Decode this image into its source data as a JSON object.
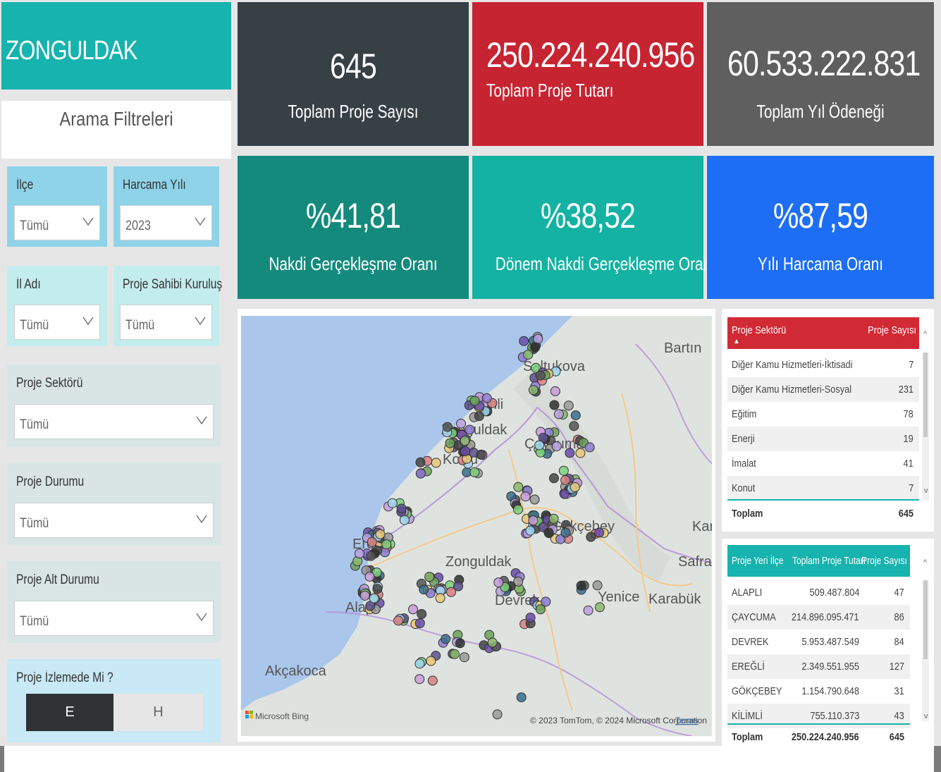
{
  "title": "ZONGULDAK",
  "filters": {
    "header": "Arama Filtreleri",
    "ilce": {
      "label": "İlçe",
      "value": "Tümü"
    },
    "harcama_yili": {
      "label": "Harcama Yılı",
      "value": "2023"
    },
    "il_adi": {
      "label": "İl Adı",
      "value": "Tümü"
    },
    "proje_sahibi": {
      "label": "Proje Sahibi Kuruluş",
      "value": "Tümü"
    },
    "proje_sektoru": {
      "label": "Proje Sektörü",
      "value": "Tümü"
    },
    "proje_durumu": {
      "label": "Proje Durumu",
      "value": "Tümü"
    },
    "proje_alt_durumu": {
      "label": "Proje Alt Durumu",
      "value": "Tümü"
    },
    "proje_izlemede": {
      "label": "Proje İzlemede Mi ?",
      "option_e": "E",
      "option_h": "H",
      "selected": "E"
    }
  },
  "kpis": {
    "proje_sayisi": {
      "value": "645",
      "label": "Toplam Proje Sayısı",
      "color": "#374045"
    },
    "proje_tutari": {
      "value": "250.224.240.956",
      "label": "Toplam Proje Tutarı",
      "color": "#c72432"
    },
    "yil_odenegi": {
      "value": "60.533.222.831",
      "label": "Toplam Yıl Ödeneği",
      "color": "#5f5f5f"
    },
    "nakdi": {
      "value": "%41,81",
      "label": "Nakdi Gerçekleşme Oranı",
      "color": "#138a7c"
    },
    "donem_nakdi": {
      "value": "%38,52",
      "label": "Dönem Nakdi Gerçekleşme Oranı",
      "color": "#13b2a2"
    },
    "harcama": {
      "value": "%87,59",
      "label": "Yılı Harcama Oranı",
      "color": "#1d6ef5"
    }
  },
  "map": {
    "labels": {
      "bartin": "Bartın",
      "kilimli": "Kilimli",
      "zonguldak_top": "Zonguldak",
      "kozlu": "Kozlu",
      "caycuma": "Çaycuma",
      "kara": "Kara",
      "safran": "Safran",
      "eregli": "Ereğli",
      "zonguldak": "Zonguldak",
      "alapli": "Alaplı",
      "devrek": "Devrek",
      "yenice": "Yenice",
      "karabuk": "Karabük",
      "akcakoca": "Akçakoca",
      "gokcebey": "Gökçebey",
      "saltukova": "Saltukova"
    },
    "attribution": "© 2023 TomTom, © 2024 Microsoft Corporation",
    "terms": "Terms",
    "bing": "Microsoft Bing"
  },
  "sector_table": {
    "headers": [
      "Proje Sektörü",
      "Proje Sayısı"
    ],
    "rows": [
      {
        "name": "Diğer Kamu Hizmetleri-İktisadi",
        "count": "7"
      },
      {
        "name": "Diğer Kamu Hizmetleri-Sosyal",
        "count": "231"
      },
      {
        "name": "Eğitim",
        "count": "78"
      },
      {
        "name": "Enerji",
        "count": "19"
      },
      {
        "name": "İmalat",
        "count": "41"
      },
      {
        "name": "Konut",
        "count": "7"
      }
    ],
    "total_label": "Toplam",
    "total": "645"
  },
  "district_table": {
    "headers": [
      "Proje Yeri İlçe",
      "Toplam Proje Tutarı",
      "Proje Sayısı"
    ],
    "rows": [
      {
        "name": "ALAPLI",
        "amount": "509.487.804",
        "count": "47"
      },
      {
        "name": "ÇAYCUMA",
        "amount": "214.896.095.471",
        "count": "86"
      },
      {
        "name": "DEVREK",
        "amount": "5.953.487.549",
        "count": "84"
      },
      {
        "name": "EREĞLİ",
        "amount": "2.349.551.955",
        "count": "127"
      },
      {
        "name": "GÖKÇEBEY",
        "amount": "1.154.790.648",
        "count": "31"
      },
      {
        "name": "KİLİMLİ",
        "amount": "755.110.373",
        "count": "43"
      }
    ],
    "total_label": "Toplam",
    "total_amount": "250.224.240.956",
    "total_count": "645"
  }
}
